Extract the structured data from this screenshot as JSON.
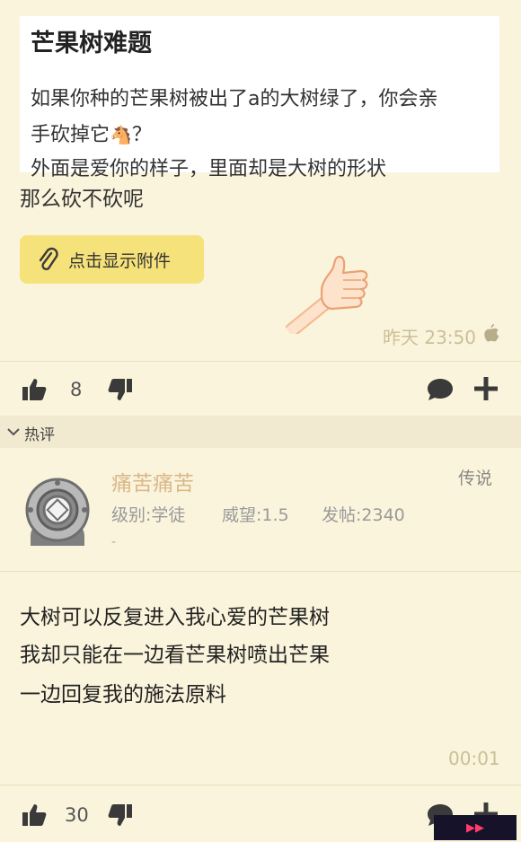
{
  "post": {
    "quote": {
      "title": "芒果树难题",
      "line1": "如果你种的芒果树被出了a的大树绿了，你会亲",
      "line2": "手砍掉它",
      "line2_emoji": "🐴",
      "line2_tail": "？",
      "line3": "外面是爱你的样子，里面却是大树的形状"
    },
    "text": "那么砍不砍呢",
    "attachment_label": "点击显示附件",
    "time": "昨天 23:50",
    "device_icon": "apple-icon",
    "likes": "8"
  },
  "hot_section": {
    "label": "热评"
  },
  "comment": {
    "username": "痛苦痛苦",
    "rank": "传说",
    "level": "级别:学徒",
    "prestige": "威望:1.5",
    "posts": "发帖:2340",
    "dash": "-",
    "lines": [
      "大树可以反复进入我心爱的芒果树",
      "我却只能在一边看芒果树喷出芒果",
      "一边回复我的施法原料"
    ],
    "time": "00:01",
    "likes": "30"
  },
  "colors": {
    "background": "#fbf4dc",
    "attachment_button": "#f6e27a",
    "username": "#d9b88a",
    "timestamp": "#cbbf97",
    "icon": "#3a3a3a"
  }
}
